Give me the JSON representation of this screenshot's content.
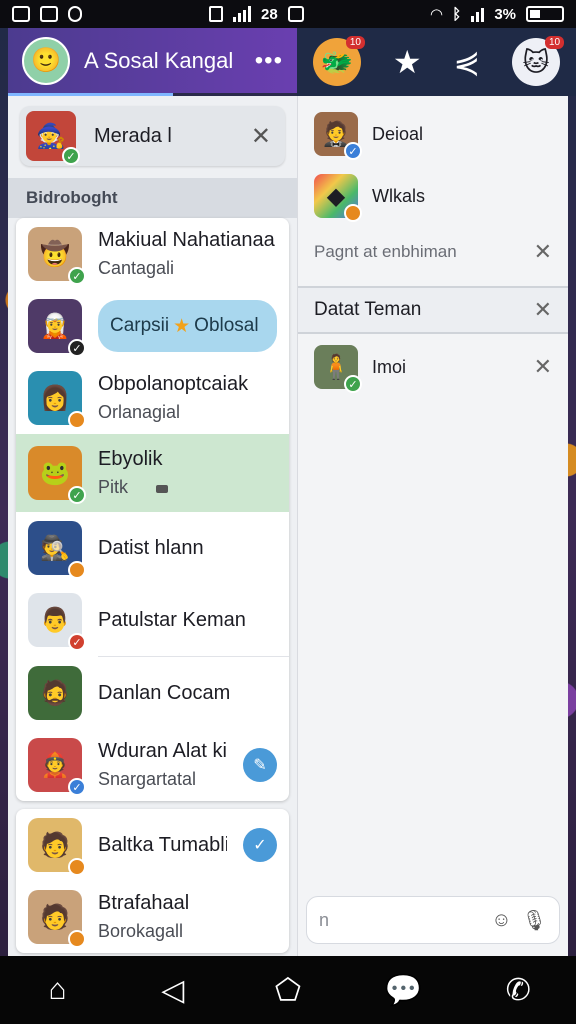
{
  "status_bar": {
    "time": "28",
    "battery": "3%"
  },
  "left_panel": {
    "header": {
      "title": "A Sosal Kangal",
      "avatar_icon": "person-avatar",
      "more_icon": "more-dots-icon"
    },
    "search": {
      "text": "Merada l"
    },
    "section_title": "Bidroboght",
    "contacts_group1": [
      {
        "name": "Makiual Nahatianaa",
        "sub": "Cantagali"
      },
      {
        "name": "Carpsii",
        "sub": "Oblosal",
        "style": "pill"
      },
      {
        "name": "Obpolanoptcaiak",
        "sub": "Orlanagial"
      },
      {
        "name": "Ebyolik",
        "sub": "Pitk",
        "highlight": true
      },
      {
        "name": "Datist hlann",
        "sub": ""
      },
      {
        "name": "Patulstar Keman",
        "sub": ""
      },
      {
        "name": "Danlan Cocam",
        "sub": ""
      },
      {
        "name": "Wduran Alat kind",
        "sub": "Snargartatal"
      }
    ],
    "contacts_group2": [
      {
        "name": "Baltka Tumablit",
        "sub": ""
      },
      {
        "name": "Btrafahaal",
        "sub": "Borokagall"
      }
    ]
  },
  "right_header": {
    "star_icon": "star-icon",
    "share_icon": "share-icon",
    "badge_left": "10",
    "badge_right": "10"
  },
  "right_panel": {
    "items": [
      {
        "name": "Deioal"
      },
      {
        "name": "Wlkals"
      }
    ],
    "placeholder_row": "Pagnt at enbhiman",
    "section_title": "Datat Teman",
    "item3": "Imoi",
    "compose_placeholder": "n"
  },
  "colors": {
    "header_purple": "#5a3ea0",
    "highlight_green": "#cde7d0",
    "pill_blue": "#a9d7ee",
    "accent_blue": "#4a9ad8"
  }
}
